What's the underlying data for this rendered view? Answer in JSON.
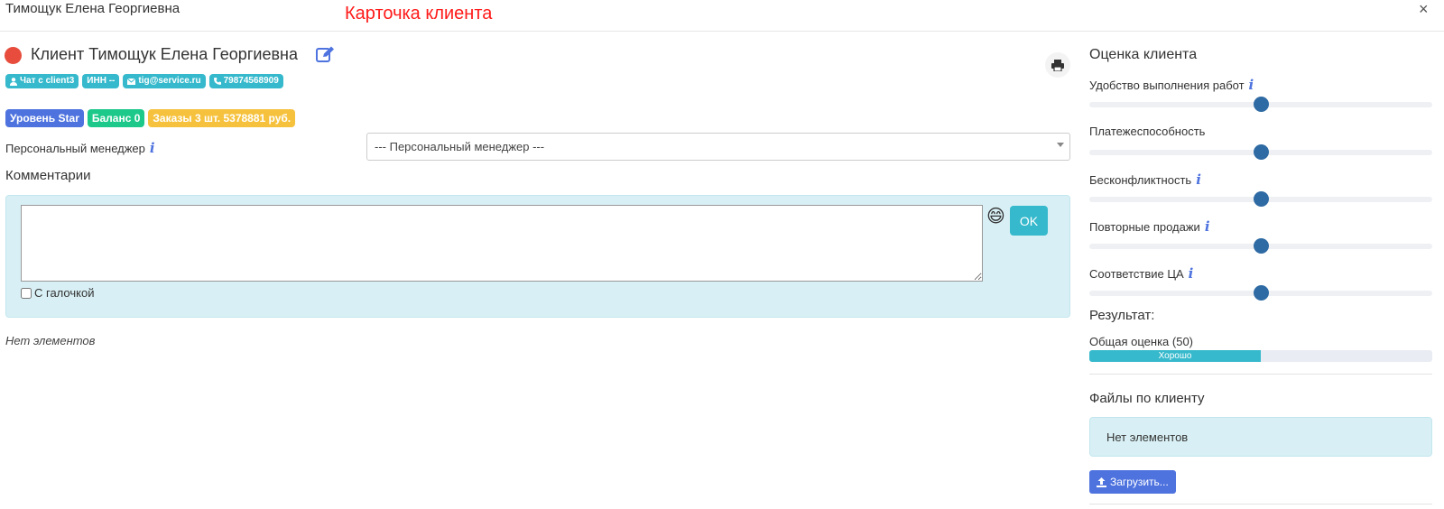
{
  "window": {
    "title": "Тимощук Елена Георгиевна",
    "annotation": "Карточка клиента",
    "close_label": "×"
  },
  "client": {
    "title": "Клиент Тимощук Елена Георгиевна",
    "status_color": "#e74c3c",
    "badges": [
      {
        "icon": "user-icon",
        "label": "Чат с client3"
      },
      {
        "icon": "",
        "label": "ИНН --"
      },
      {
        "icon": "envelope-icon",
        "label": "tig@service.ru"
      },
      {
        "icon": "phone-icon",
        "label": "79874568909"
      }
    ],
    "level_badge": "Уровень Star",
    "balance_badge": "Баланс 0",
    "orders_badge": "Заказы 3 шт. 5378881 руб."
  },
  "manager": {
    "label": "Персональный менеджер",
    "selected": "--- Персональный менеджер ---"
  },
  "comments": {
    "heading": "Комментарии",
    "textarea_value": "",
    "emoji": "😄",
    "ok_label": "OK",
    "checkbox_label": "С галочкой",
    "empty_text": "Нет элементов"
  },
  "rating": {
    "heading": "Оценка клиента",
    "sliders": [
      {
        "label": "Удобство выполнения работ",
        "info": true,
        "value": 50
      },
      {
        "label": "Платежеспособность",
        "info": false,
        "value": 50
      },
      {
        "label": "Бесконфликтность",
        "info": true,
        "value": 50
      },
      {
        "label": "Повторные продажи",
        "info": true,
        "value": 50
      },
      {
        "label": "Соответствие ЦА",
        "info": true,
        "value": 50
      }
    ],
    "result_label": "Результат:",
    "overall_label": "Общая оценка (50)",
    "overall_value": 50,
    "progress_text": "Хорошо"
  },
  "files": {
    "heading": "Файлы по клиенту",
    "empty_text": "Нет элементов",
    "upload_label": "Загрузить..."
  },
  "colors": {
    "info": "#36b9cc",
    "primary": "#4e73df",
    "success": "#1cc88a",
    "warning": "#f6c23e",
    "annotation": "#ff1a1a"
  }
}
